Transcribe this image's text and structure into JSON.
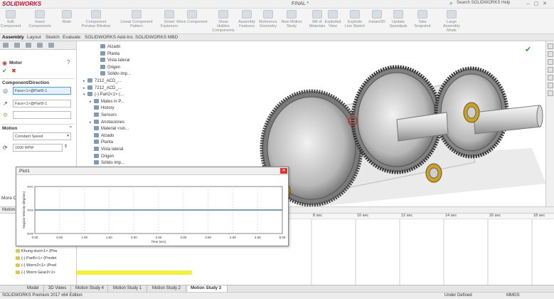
{
  "titlebar": {
    "logo": "SOLIDWORKS",
    "document": "FINAL *",
    "search_placeholder": "Search SOLIDWORKS Help"
  },
  "ribbon": {
    "buttons": [
      "Edit Component",
      "Insert Components",
      "Mate",
      "Component Preview Window",
      "Linear Component Pattern",
      "Smart Fasteners",
      "Move Component",
      "Show Hidden Components",
      "Assembly Features",
      "Reference Geometry",
      "New Motion Study",
      "Bill of Materials",
      "Exploded View",
      "Explode Line Sketch",
      "Instant3D",
      "Update Speedpak",
      "Take Snapshot",
      "Large Assembly Mode"
    ]
  },
  "command_tabs": [
    "Assembly",
    "Layout",
    "Sketch",
    "Evaluate",
    "SOLIDWORKS Add-Ins",
    "SOLIDWORKS MBD"
  ],
  "property_manager": {
    "title": "Motor",
    "section_component": "Component/Direction",
    "face_1": "Face<1>@Part5-1",
    "face_2": "Face<1>@Part5-1",
    "section_motion": "Motion",
    "motion_type": "Constant Speed",
    "speed": "1500 RPM",
    "more_options": "More Op"
  },
  "tree": {
    "items": [
      {
        "label": "Alzado",
        "indent": 3,
        "expand": ""
      },
      {
        "label": "Planta",
        "indent": 3,
        "expand": ""
      },
      {
        "label": "Vista lateral",
        "indent": 3,
        "expand": ""
      },
      {
        "label": "Origen",
        "indent": 3,
        "expand": ""
      },
      {
        "label": "Sólido imp...",
        "indent": 3,
        "expand": ""
      },
      {
        "label": "7212_ACD_...",
        "indent": 1,
        "expand": "▸"
      },
      {
        "label": "7212_ACD_...",
        "indent": 1,
        "expand": "▸"
      },
      {
        "label": "(-) Part2<1> (...",
        "indent": 1,
        "expand": "▾"
      },
      {
        "label": "Mates in P...",
        "indent": 2,
        "expand": "▸"
      },
      {
        "label": "History",
        "indent": 2,
        "expand": ""
      },
      {
        "label": "Sensors",
        "indent": 2,
        "expand": ""
      },
      {
        "label": "Anotaciones",
        "indent": 2,
        "expand": "▸"
      },
      {
        "label": "Material <sin...",
        "indent": 2,
        "expand": ""
      },
      {
        "label": "Alzado",
        "indent": 2,
        "expand": ""
      },
      {
        "label": "Planta",
        "indent": 2,
        "expand": ""
      },
      {
        "label": "Vista lateral",
        "indent": 2,
        "expand": ""
      },
      {
        "label": "Origen",
        "indent": 2,
        "expand": ""
      },
      {
        "label": "Sólido imp...",
        "indent": 2,
        "expand": ""
      }
    ]
  },
  "plot": {
    "title": "Plot1"
  },
  "chart_data": {
    "type": "line",
    "title": "",
    "xlabel": "Time (sec)",
    "ylabel": "Angular Velocity (deg/sec)",
    "x_ticks": [
      "0.00",
      "0.50",
      "1.00",
      "1.50",
      "2.00",
      "2.50",
      "3.00",
      "3.50",
      "4.00",
      "4.50",
      "5.00"
    ],
    "y_ticks": [
      "9001",
      "9000",
      "8999"
    ],
    "ylim": [
      8999,
      9001
    ],
    "xlim": [
      0,
      5
    ],
    "series": [
      {
        "x": [
          0,
          5
        ],
        "y": [
          9000,
          9000
        ]
      }
    ]
  },
  "motion_manager": {
    "tab_label": "Motion",
    "time_ticks": [
      "8 sec",
      "10 sec",
      "12 sec",
      "14 sec",
      "16 sec",
      "18 sec"
    ],
    "rows": [
      "Khung duoi<1> (Phe",
      "(-) Part5<1> (Predet",
      "(-) Worm2<1> (Pred",
      "(-) Worm Gear2<1>"
    ]
  },
  "bottom_tabs": [
    "Model",
    "3D Views",
    "Motion Study 4",
    "Motion Study 1",
    "Motion Study 2",
    "Motion Study 3"
  ],
  "status": {
    "left": "SOLIDWORKS Premium 2017 x64 Edition",
    "units": "Under Defined",
    "mmgs": "MMGS"
  }
}
